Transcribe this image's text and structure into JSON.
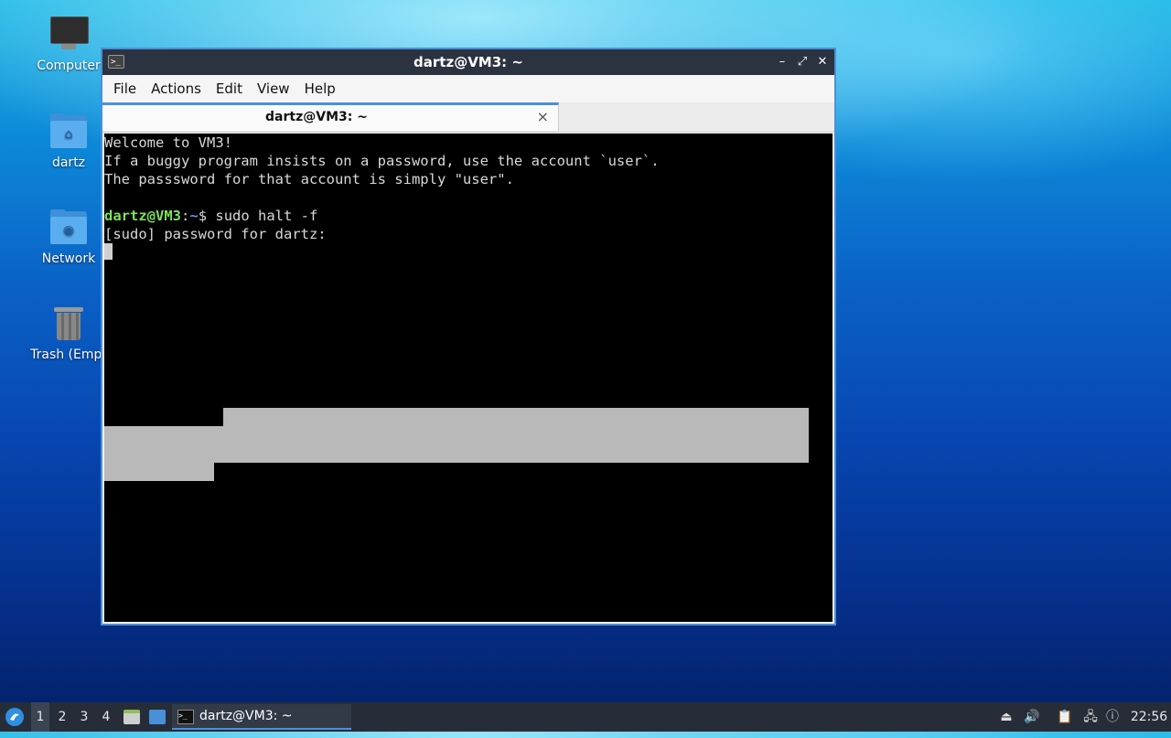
{
  "desktop": {
    "icons": [
      {
        "label": "Computer",
        "icon": "computer-icon"
      },
      {
        "label": "dartz",
        "icon": "home-folder-icon"
      },
      {
        "label": "Network",
        "icon": "network-folder-icon"
      },
      {
        "label": "Trash (Empt",
        "icon": "trash-icon"
      }
    ]
  },
  "window": {
    "title": "dartz@VM3: ~",
    "controls": {
      "minimize": "–",
      "maximize": "⤢",
      "close": "✕"
    },
    "menu": [
      "File",
      "Actions",
      "Edit",
      "View",
      "Help"
    ],
    "tab": {
      "label": "dartz@VM3: ~",
      "close": "×"
    }
  },
  "terminal": {
    "lines": [
      "Welcome to VM3!",
      "If a buggy program insists on a password, use the account `user`.",
      "The passsword for that account is simply \"user\"."
    ],
    "prompt_user": "dartz@VM3",
    "prompt_sep": ":",
    "prompt_path": "~",
    "prompt_symbol": "$ ",
    "command": "sudo halt -f",
    "sudo_prompt": "[sudo] password for dartz:"
  },
  "taskbar": {
    "workspaces": [
      "1",
      "2",
      "3",
      "4"
    ],
    "active_workspace": "1",
    "task_label": "dartz@VM3: ~",
    "clock": "22:56"
  },
  "colors": {
    "window_border": "#4a90d9",
    "titlebar_bg": "#2b3340",
    "terminal_bg": "#000000",
    "prompt_user": "#7ee05e",
    "prompt_path": "#5b9bf5",
    "taskbar_bg": "#262d38"
  }
}
